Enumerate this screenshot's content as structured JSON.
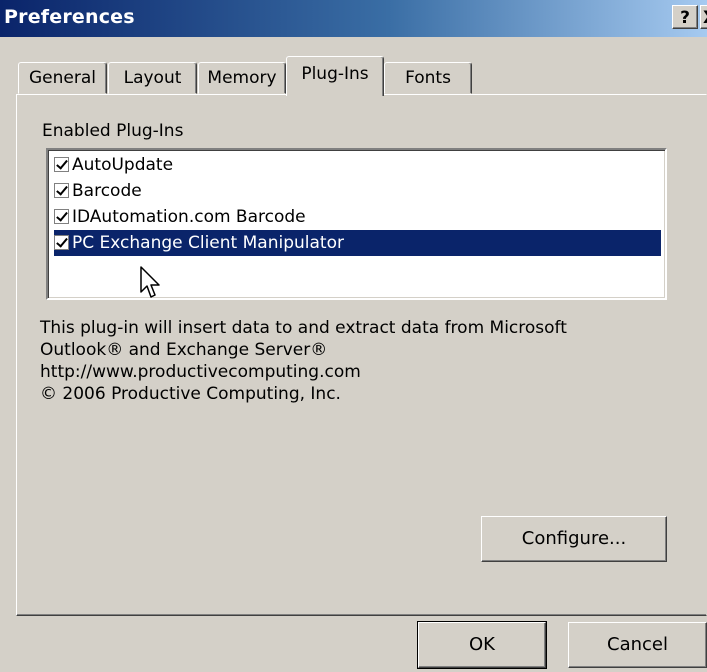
{
  "window": {
    "title": "Preferences",
    "help_glyph": "?",
    "close_glyph": "X"
  },
  "tabs": [
    {
      "label": "General",
      "active": false
    },
    {
      "label": "Layout",
      "active": false
    },
    {
      "label": "Memory",
      "active": false
    },
    {
      "label": "Plug-Ins",
      "active": true
    },
    {
      "label": "Fonts",
      "active": false
    }
  ],
  "plugins": {
    "group_label": "Enabled Plug-Ins",
    "items": [
      {
        "label": "AutoUpdate",
        "checked": true
      },
      {
        "label": "Barcode",
        "checked": true
      },
      {
        "label": "IDAutomation.com Barcode",
        "checked": true
      },
      {
        "label": "PC Exchange Client Manipulator",
        "checked": true,
        "selected": true
      }
    ],
    "description": [
      "This plug-in will insert data to and extract data from Microsoft",
      "Outlook® and Exchange Server®",
      "http://www.productivecomputing.com",
      "© 2006 Productive Computing, Inc."
    ],
    "configure_label": "Configure..."
  },
  "footer": {
    "ok_label": "OK",
    "cancel_label": "Cancel"
  },
  "colors": {
    "face": "#d4d0c8",
    "titlebar_start": "#0a246a",
    "selection": "#0a246a"
  }
}
